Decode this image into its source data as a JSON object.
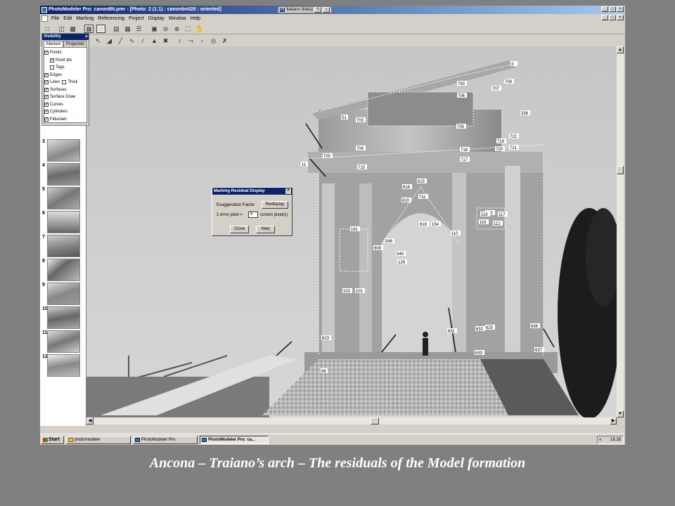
{
  "window": {
    "title": "PhotoModeler Pro: canon8N.pmr - [Photo: 2 (1:1) : canonbn020 : oriented]",
    "language": "Italiano (Italia)",
    "lang_badge": "IT"
  },
  "menu": [
    "File",
    "Edit",
    "Marking",
    "Referencing",
    "Project",
    "Display",
    "Window",
    "Help"
  ],
  "visibility_panel": {
    "title": "Visibility",
    "tabs": [
      "Marked",
      "Projected"
    ],
    "items": [
      {
        "label": "Points",
        "checked": true,
        "indent": 0
      },
      {
        "label": "Point Ids",
        "checked": true,
        "indent": 1
      },
      {
        "label": "Tags",
        "checked": false,
        "indent": 1
      },
      {
        "label": "Edges",
        "checked": true,
        "indent": 0
      },
      {
        "label": "Lines",
        "checked": true,
        "indent": 0
      },
      {
        "label": "Surfaces",
        "checked": true,
        "indent": 0
      },
      {
        "label": "Surface Draw",
        "checked": true,
        "indent": 0
      },
      {
        "label": "Curves",
        "checked": true,
        "indent": 0
      },
      {
        "label": "Cylinders",
        "checked": true,
        "indent": 0
      },
      {
        "label": "Fiducials",
        "checked": true,
        "indent": 0
      }
    ],
    "thick_label": "Thick",
    "thick_checked": false
  },
  "thumbnails": [
    "3",
    "4",
    "5",
    "6",
    "7",
    "8",
    "9",
    "10",
    "11",
    "12"
  ],
  "dialog": {
    "title": "Marking Residual Display",
    "factor_label": "Exaggeration Factor",
    "redisplay": "Redisplay",
    "error_label": "1 error pixel =",
    "error_value": "5",
    "unit_label": "screen pixel(s)",
    "close": "Close",
    "help": "Help"
  },
  "point_labels": [
    "3",
    "793",
    "708",
    "707",
    "706",
    "705",
    "338",
    "722",
    "721",
    "719",
    "720",
    "718",
    "717",
    "51",
    "703",
    "704",
    "700",
    "11",
    "715",
    "711",
    "615",
    "616",
    "610",
    "609",
    "618",
    "154",
    "110",
    "113",
    "112",
    "116",
    "118",
    "117",
    "161",
    "548",
    "549",
    "129",
    "102",
    "101",
    "631",
    "633",
    "636",
    "637",
    "632",
    "625",
    "623",
    "88"
  ],
  "taskbar": {
    "start": "Start",
    "tasks": [
      "photomodeler",
      "PhotoModeler Pro",
      "PhotoModeler Pro: ca..."
    ],
    "tray_arrows": "«",
    "clock": "18.28"
  },
  "caption": "Ancona – Traiano’s arch – The residuals of the Model formation"
}
